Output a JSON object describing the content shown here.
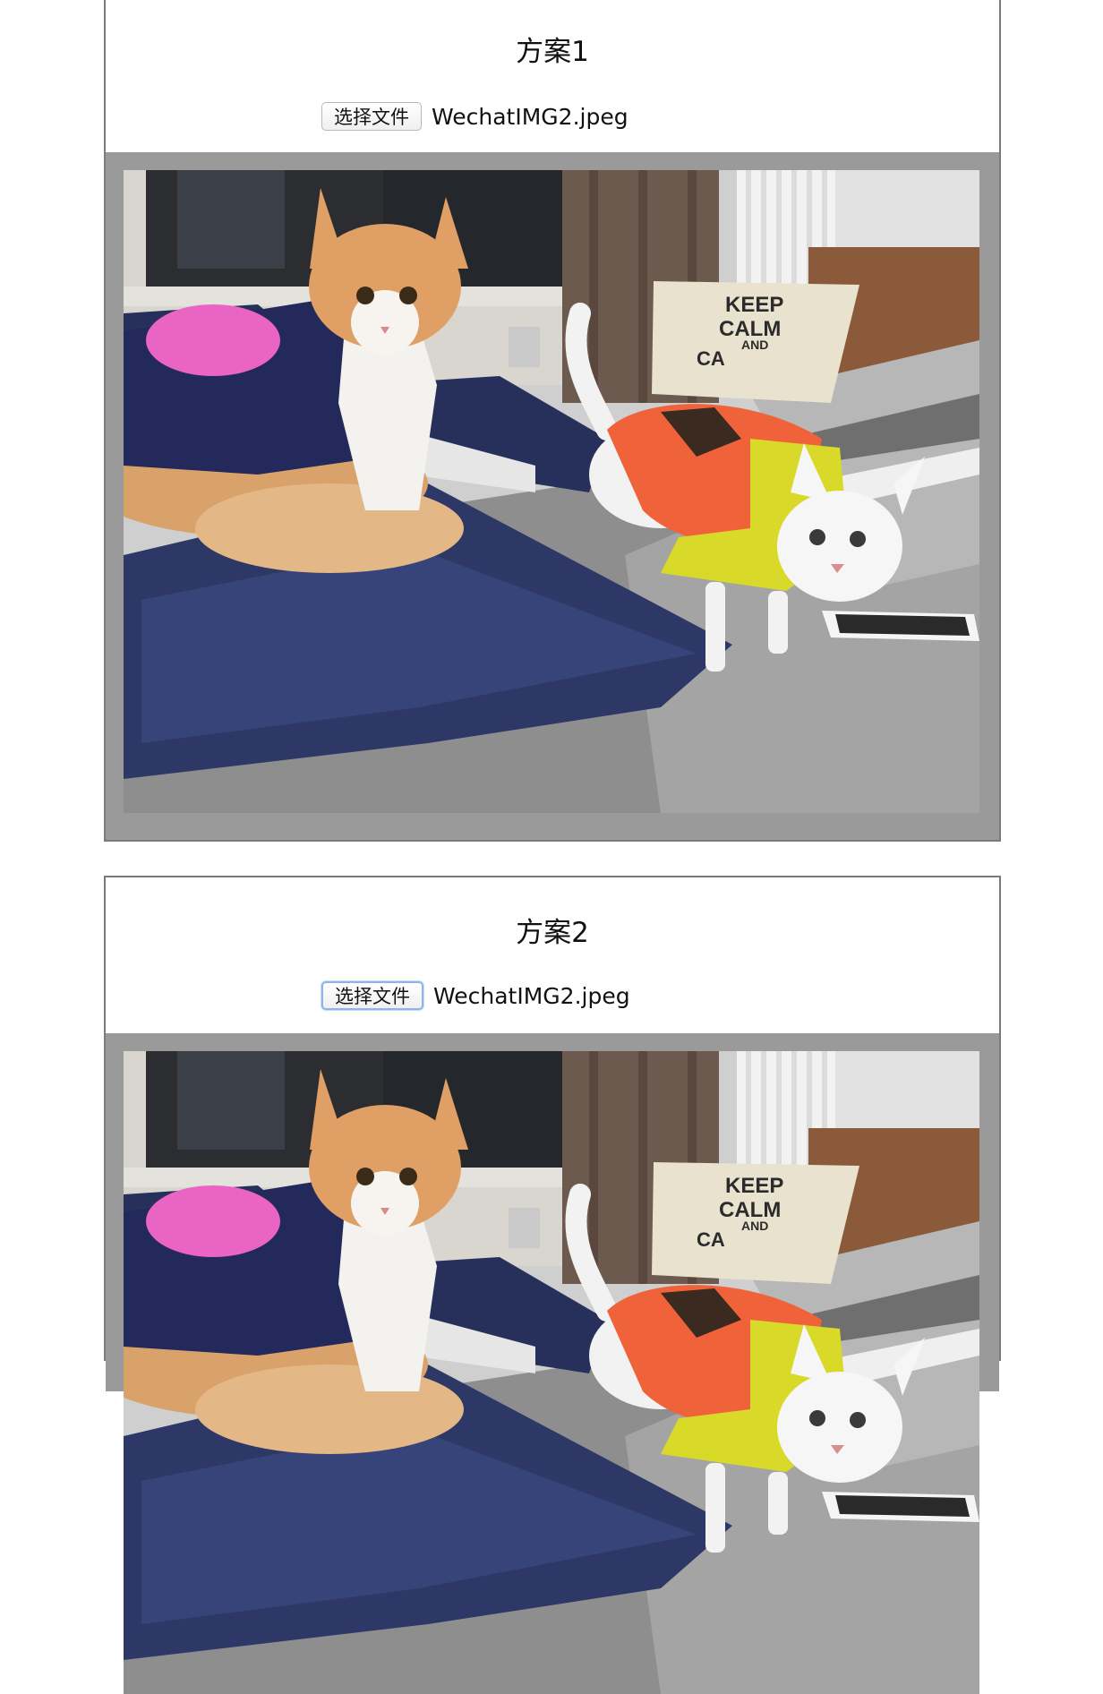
{
  "panels": [
    {
      "title": "方案1",
      "file_button_label": "选择文件",
      "file_name": "WechatIMG2.jpeg",
      "preview_image": "photo-two-cats-on-bed"
    },
    {
      "title": "方案2",
      "file_button_label": "选择文件",
      "file_name": "WechatIMG2.jpeg",
      "preview_image": "photo-two-cats-on-bed"
    }
  ],
  "photo_text": {
    "pillow_line1": "KEEP",
    "pillow_line2": "CALM",
    "pillow_line3": "AND",
    "pillow_line4": "CA"
  },
  "colors": {
    "preview_background": "#9a9a9a",
    "panel_border": "#7a7a7a",
    "focus_ring": "#8fb4e9"
  }
}
